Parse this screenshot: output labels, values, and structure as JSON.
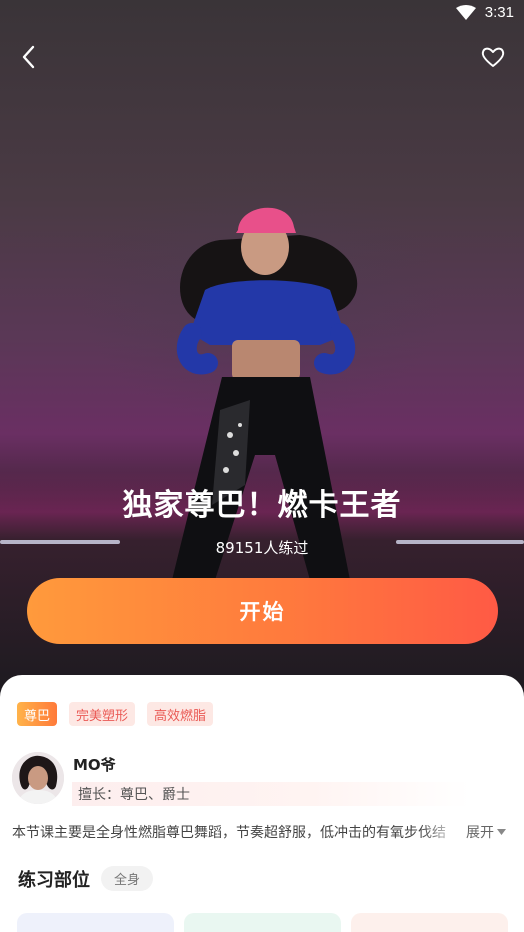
{
  "status_bar": {
    "time": "3:31"
  },
  "course": {
    "title": "独家尊巴！燃卡王者",
    "practiced_count": "89151人练过",
    "start_label": "开始"
  },
  "tags": [
    "尊巴",
    "完美塑形",
    "高效燃脂"
  ],
  "coach": {
    "name": "MO爷",
    "specialty": "擅长：尊巴、爵士"
  },
  "description": {
    "text": "本节课主要是全身性燃脂尊巴舞蹈，节奏超舒服，低冲击的有氧步伐结",
    "expand_label": "展开"
  },
  "practice_parts": {
    "title": "练习部位",
    "value": "全身"
  },
  "icons": {
    "back": "chevron-left-icon",
    "favorite": "heart-outline-icon",
    "wifi": "wifi-icon",
    "expand": "caret-down-icon"
  },
  "colors": {
    "start_gradient_left": "#ff9a3c",
    "start_gradient_right": "#ff5a45",
    "tag_text": "#ea5a55"
  }
}
